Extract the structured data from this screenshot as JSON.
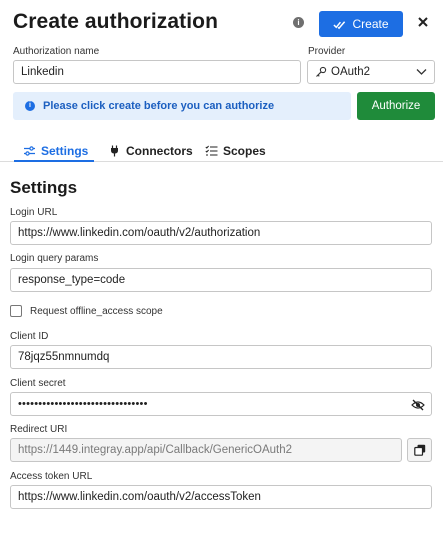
{
  "header": {
    "title": "Create authorization",
    "create_label": "Create"
  },
  "form": {
    "auth_name_label": "Authorization name",
    "auth_name_value": "Linkedin",
    "provider_label": "Provider",
    "provider_value": "OAuth2"
  },
  "alert": {
    "message": "Please click create before you can authorize",
    "authorize_label": "Authorize"
  },
  "tabs": [
    {
      "label": "Settings",
      "active": true,
      "icon": "sliders-icon"
    },
    {
      "label": "Connectors",
      "active": false,
      "icon": "plug-icon"
    },
    {
      "label": "Scopes",
      "active": false,
      "icon": "list-check-icon"
    }
  ],
  "settings": {
    "title": "Settings",
    "login_url_label": "Login URL",
    "login_url_value": "https://www.linkedin.com/oauth/v2/authorization",
    "login_params_label": "Login query params",
    "login_params_value": "response_type=code",
    "offline_label": "Request offline_access scope",
    "offline_checked": false,
    "client_id_label": "Client ID",
    "client_id_value": "78jqz55nmnumdq",
    "client_secret_label": "Client secret",
    "client_secret_value": "••••••••••••••••••••••••••••••••",
    "redirect_label": "Redirect URI",
    "redirect_value": "https://1449.integray.app/api/Callback/GenericOAuth2",
    "access_token_label": "Access token URL",
    "access_token_value": "https://www.linkedin.com/oauth/v2/accessToken"
  },
  "colors": {
    "primary": "#1d6ee3",
    "success": "#1f8b3a",
    "alert_bg": "#e4effc",
    "alert_text": "#1c5fc0"
  }
}
